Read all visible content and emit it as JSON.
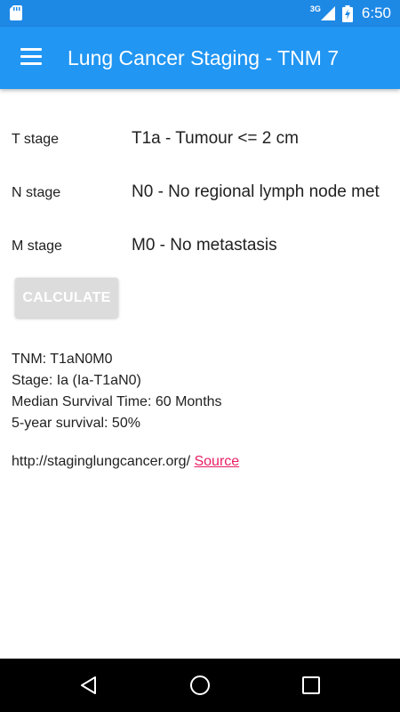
{
  "status_bar": {
    "network_type": "3G",
    "time": "6:50",
    "icons": [
      "sd-card-icon",
      "signal-icon",
      "battery-charging-icon"
    ]
  },
  "app_bar": {
    "title": "Lung Cancer Staging - TNM 7",
    "menu_icon": "hamburger-menu-icon"
  },
  "stages": [
    {
      "label": "T stage",
      "value": "T1a - Tumour <= 2 cm"
    },
    {
      "label": "N stage",
      "value": "N0 - No regional lymph node met"
    },
    {
      "label": "M stage",
      "value": "M0 - No metastasis"
    }
  ],
  "calculate_label": "CALCULATE",
  "results": {
    "tnm": "TNM:  T1aN0M0",
    "stage": "Stage:  Ia (Ia-T1aN0)",
    "median_survival": "Median Survival Time: 60 Months",
    "five_year_survival": "5-year survival: 50%"
  },
  "source": {
    "url_text": "http://staginglungcancer.org/",
    "link_label": "Source"
  },
  "colors": {
    "status_bar": "#1e88e5",
    "app_bar": "#2196f3",
    "link": "#e91e63",
    "button_disabled": "#dcdcdc"
  },
  "nav_bar": {
    "icons": [
      "back-icon",
      "home-icon",
      "recents-icon"
    ]
  }
}
